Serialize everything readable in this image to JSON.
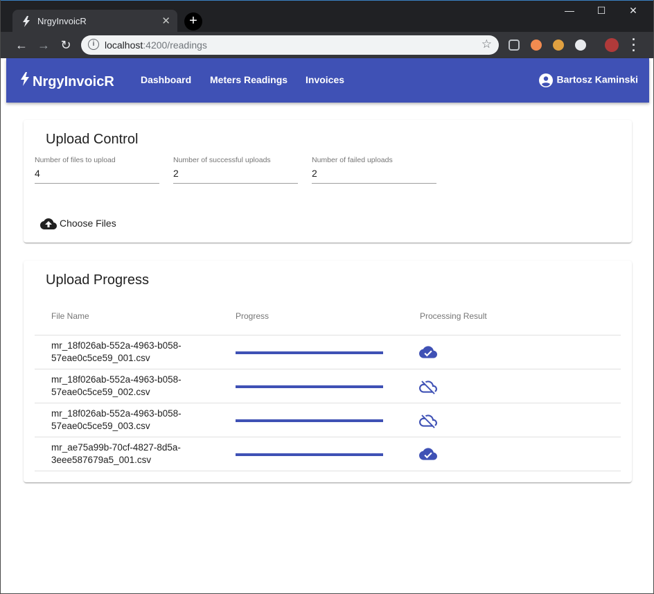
{
  "browser": {
    "tab_title": "NrgyInvoicR",
    "url_host": "localhost",
    "url_path": ":4200/readings"
  },
  "app": {
    "brand": "NrgyInvoicR",
    "nav": [
      {
        "label": "Dashboard"
      },
      {
        "label": "Meters Readings"
      },
      {
        "label": "Invoices"
      }
    ],
    "user_name": "Bartosz Kaminski",
    "accent_color": "#3f51b5"
  },
  "upload_control": {
    "title": "Upload Control",
    "fields": [
      {
        "label": "Number of files to upload",
        "value": "4"
      },
      {
        "label": "Number of successful uploads",
        "value": "2"
      },
      {
        "label": "Number of failed uploads",
        "value": "2"
      }
    ],
    "choose_files_label": "Choose Files"
  },
  "upload_progress": {
    "title": "Upload Progress",
    "columns": [
      "File Name",
      "Progress",
      "Processing Result"
    ],
    "rows": [
      {
        "name_line1": "mr_18f026ab-552a-4963-b058-",
        "name_line2": "57eae0c5ce59_001.csv",
        "progress": 1.0,
        "result_icon": "cloud-done-icon"
      },
      {
        "name_line1": "mr_18f026ab-552a-4963-b058-",
        "name_line2": "57eae0c5ce59_002.csv",
        "progress": 1.0,
        "result_icon": "cloud-off-icon"
      },
      {
        "name_line1": "mr_18f026ab-552a-4963-b058-",
        "name_line2": "57eae0c5ce59_003.csv",
        "progress": 1.0,
        "result_icon": "cloud-off-icon"
      },
      {
        "name_line1": "mr_ae75a99b-70cf-4827-8d5a-",
        "name_line2": "3eee587679a5_001.csv",
        "progress": 1.0,
        "result_icon": "cloud-done-icon"
      }
    ]
  }
}
